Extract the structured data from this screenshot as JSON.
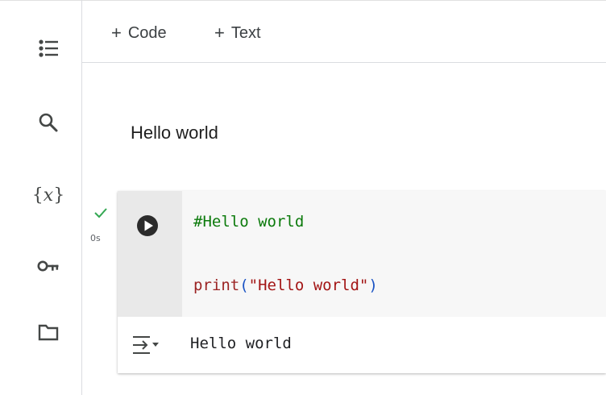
{
  "toolbar": {
    "add_code_label": "Code",
    "add_text_label": "Text",
    "plus_glyph": "+"
  },
  "sidebar": {
    "items": [
      {
        "name": "table-of-contents",
        "icon": "list-icon"
      },
      {
        "name": "find-and-replace",
        "icon": "search-icon"
      },
      {
        "name": "variables",
        "icon": "variables-icon",
        "glyph": "{x}"
      },
      {
        "name": "secrets",
        "icon": "key-icon"
      },
      {
        "name": "files",
        "icon": "folder-icon"
      }
    ]
  },
  "text_cell": {
    "heading": "Hello world"
  },
  "code_cell": {
    "status": "success",
    "check_color": "#34a853",
    "exec_time": "0s",
    "lines": {
      "comment": "#Hello world",
      "fn_name": "print",
      "open_paren": "(",
      "string_literal": "\"Hello world\"",
      "close_paren": ")"
    },
    "output": "Hello world"
  },
  "colors": {
    "icon": "#444746",
    "comment": "#0b7a0b",
    "function": "#9b2323",
    "paren": "#1a53c4",
    "string": "#a31515",
    "gutter": "#e9e9e9",
    "editor_bg": "#f7f7f7"
  }
}
